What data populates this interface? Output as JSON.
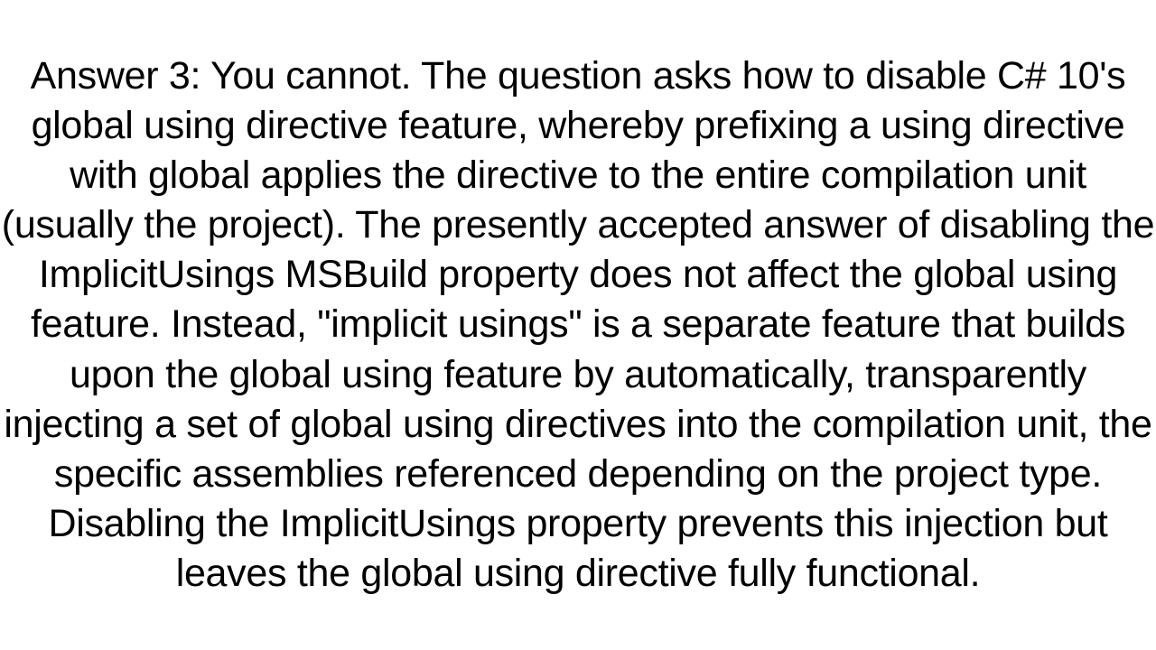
{
  "answer": {
    "text": "Answer 3: You cannot. The question asks how to disable C# 10's global using directive feature, whereby prefixing a using directive with global applies the directive to the entire compilation unit (usually the project). The presently accepted answer of disabling the ImplicitUsings MSBuild property does not affect the global using feature. Instead, \"implicit usings\" is a separate feature that builds upon the global using feature by automatically, transparently injecting a set of global using directives into the compilation unit, the specific assemblies referenced depending on the project type. Disabling the ImplicitUsings property prevents this injection but leaves the global using directive fully functional."
  }
}
